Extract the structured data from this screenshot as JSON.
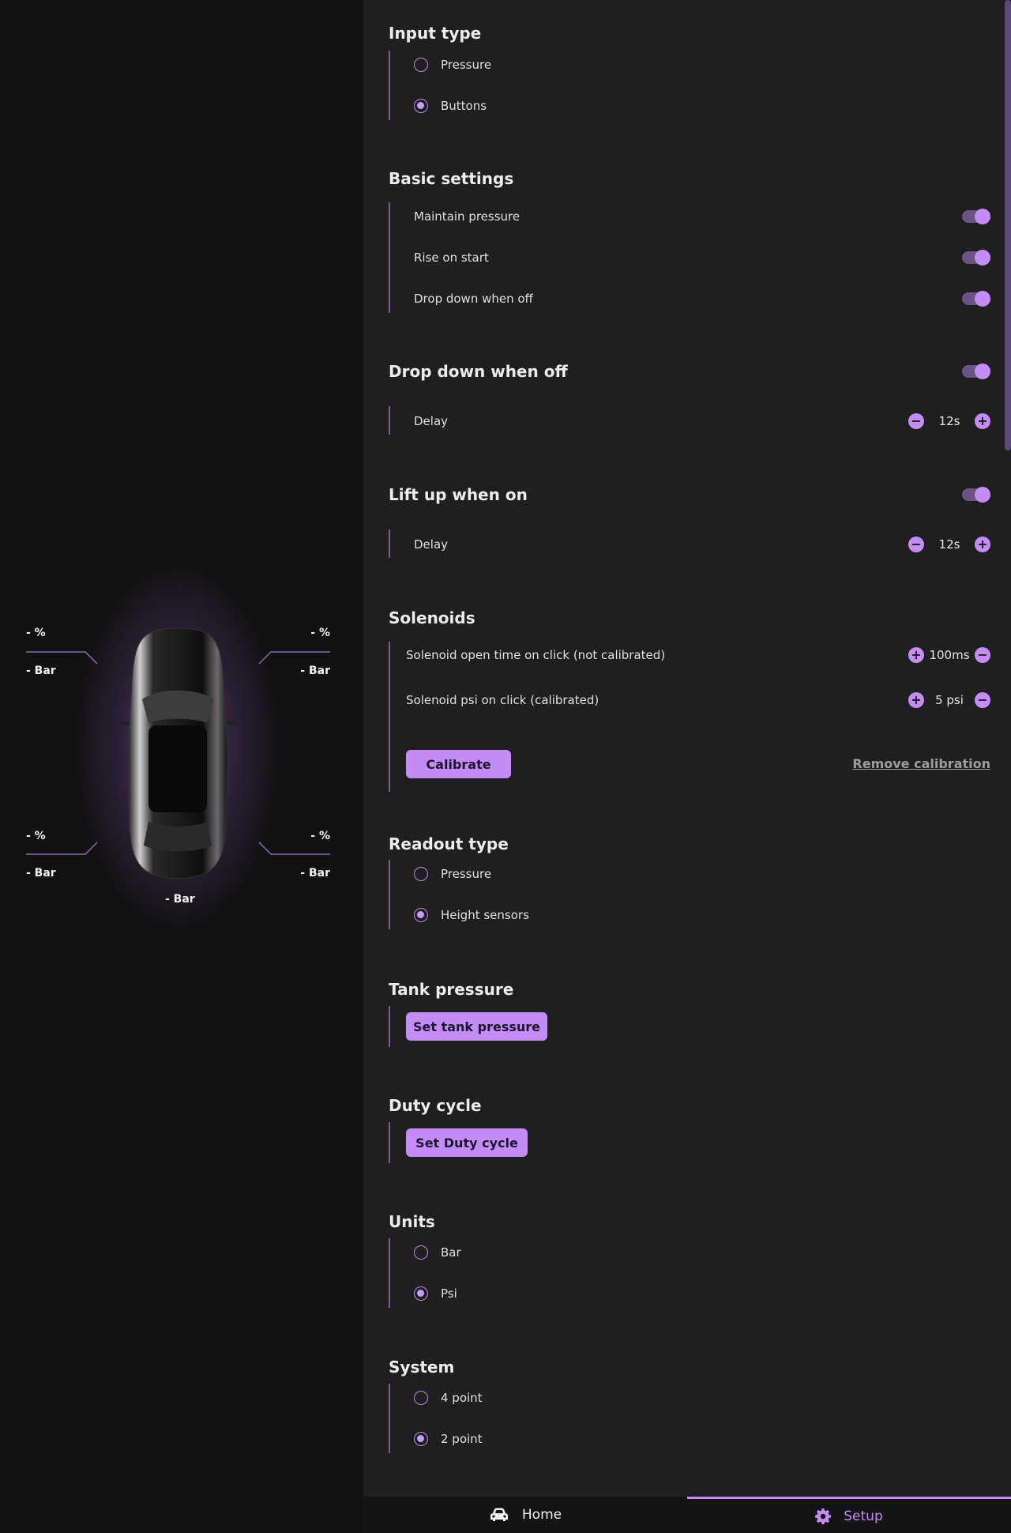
{
  "car_panel": {
    "front_left": {
      "percent": "- %",
      "pressure": "- Bar"
    },
    "front_right": {
      "percent": "- %",
      "pressure": "- Bar"
    },
    "rear_left": {
      "percent": "- %",
      "pressure": "- Bar"
    },
    "rear_right": {
      "percent": "- %",
      "pressure": "- Bar"
    },
    "tank": {
      "pressure": "- Bar"
    }
  },
  "input_type": {
    "title": "Input type",
    "options": [
      {
        "label": "Pressure",
        "selected": false
      },
      {
        "label": "Buttons",
        "selected": true
      }
    ]
  },
  "basic_settings": {
    "title": "Basic settings",
    "toggles": [
      {
        "label": "Maintain pressure",
        "on": true
      },
      {
        "label": "Rise on start",
        "on": true
      },
      {
        "label": "Drop down when off",
        "on": true
      }
    ]
  },
  "drop_down": {
    "title": "Drop down when off",
    "on": true,
    "delay_label": "Delay",
    "delay_value": "12s"
  },
  "lift_up": {
    "title": "Lift up when on",
    "on": true,
    "delay_label": "Delay",
    "delay_value": "12s"
  },
  "solenoids": {
    "title": "Solenoids",
    "open_time_label": "Solenoid open time on click (not calibrated)",
    "open_time_value": "100ms",
    "psi_label": "Solenoid psi on click (calibrated)",
    "psi_value": "5 psi",
    "calibrate_label": "Calibrate",
    "remove_label": "Remove calibration"
  },
  "readout_type": {
    "title": "Readout type",
    "options": [
      {
        "label": "Pressure",
        "selected": false
      },
      {
        "label": "Height sensors",
        "selected": true
      }
    ]
  },
  "tank_pressure": {
    "title": "Tank pressure",
    "button_label": "Set tank pressure"
  },
  "duty_cycle": {
    "title": "Duty cycle",
    "button_label": "Set Duty cycle"
  },
  "units": {
    "title": "Units",
    "options": [
      {
        "label": "Bar",
        "selected": false
      },
      {
        "label": "Psi",
        "selected": true
      }
    ]
  },
  "system": {
    "title": "System",
    "options": [
      {
        "label": "4 point",
        "selected": false
      },
      {
        "label": "2 point",
        "selected": true
      }
    ]
  },
  "nav": {
    "home_label": "Home",
    "setup_label": "Setup",
    "active": "Setup"
  },
  "colors": {
    "accent": "#c38cf7",
    "panel_bg": "#1f1f1f",
    "page_bg": "#121212"
  }
}
